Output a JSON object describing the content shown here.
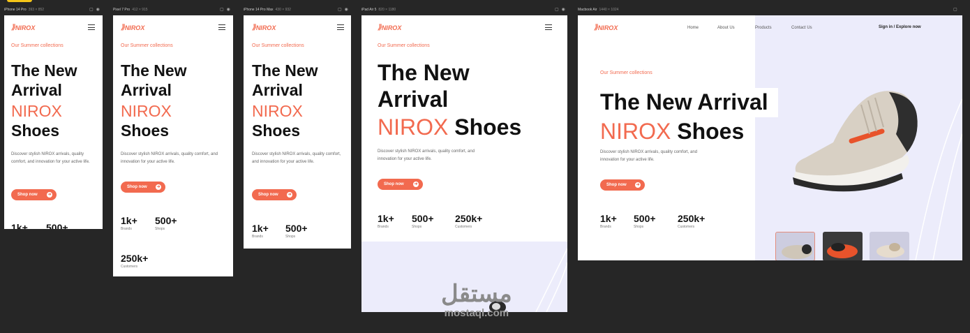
{
  "frames": [
    {
      "device": "iPhone 14 Pro",
      "size": "393 × 852"
    },
    {
      "device": "Pixel 7 Pro",
      "size": "412 × 915"
    },
    {
      "device": "iPhone 14 Pro Max",
      "size": "430 × 932"
    },
    {
      "device": "iPad Air 5",
      "size": "820 × 1180"
    },
    {
      "device": "Macbook Air",
      "size": "1440 × 1024"
    }
  ],
  "brand": "NIROX",
  "hero": {
    "eyebrow": "Our Summer collections",
    "title_line1": "The New",
    "title_line2": "Arrival",
    "title_full": "The New Arrival",
    "accent": "NIROX",
    "title_tail": "Shoes",
    "description": "Discover stylish NIROX arrivals, quality comfort, and innovation for your active life.",
    "cta": "Shop now"
  },
  "stats": [
    {
      "value": "1k+",
      "label": "Brands"
    },
    {
      "value": "500+",
      "label": "Shops"
    },
    {
      "value": "250k+",
      "label": "Customers"
    }
  ],
  "nav": {
    "items": [
      "Home",
      "About Us",
      "Products",
      "Contact Us"
    ],
    "signin": "Sign in",
    "separator": "/",
    "explore": "Explore now"
  },
  "watermark": {
    "arabic": "مستقل",
    "latin": "mostaql.com"
  },
  "colors": {
    "accent": "#f26a4f",
    "canvas": "#262626",
    "pastel": "#ececfb"
  }
}
